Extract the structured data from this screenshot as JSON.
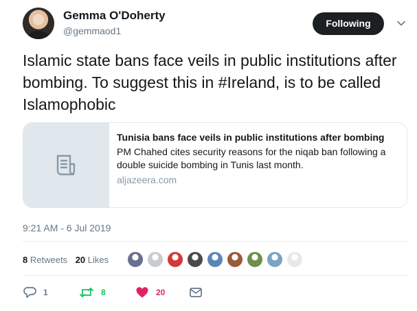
{
  "author": {
    "name": "Gemma O'Doherty",
    "handle": "@gemmaod1"
  },
  "follow_button": {
    "label": "Following"
  },
  "tweet": {
    "text": "Islamic state bans face veils in public institutions after bombing. To suggest this in #Ireland, is to be called Islamophobic",
    "timestamp": "9:21 AM - 6 Jul 2019"
  },
  "card": {
    "title": "Tunisia bans face veils in public institutions after bombing",
    "description": "PM Chahed cites security reasons for the niqab ban following a double suicide bombing in Tunis last month.",
    "domain": "aljazeera.com",
    "thumbnail_icon": "document-icon"
  },
  "stats": {
    "retweets_count": "8",
    "retweets_label": "Retweets",
    "likes_count": "20",
    "likes_label": "Likes"
  },
  "likers": [
    {
      "color": "#6a6f8f"
    },
    {
      "color": "#c7ccd1"
    },
    {
      "color": "#d23a3a"
    },
    {
      "color": "#4a4a4a"
    },
    {
      "color": "#5b86b8"
    },
    {
      "color": "#9a5a3c"
    },
    {
      "color": "#6f8f4a"
    },
    {
      "color": "#7aa4c2"
    },
    {
      "color": "#e8e8e8"
    }
  ],
  "actions": {
    "replies": "1",
    "retweets": "8",
    "likes": "20"
  },
  "colors": {
    "retweet_green": "#17bf63",
    "like_red": "#e0245e",
    "muted": "#657786"
  }
}
